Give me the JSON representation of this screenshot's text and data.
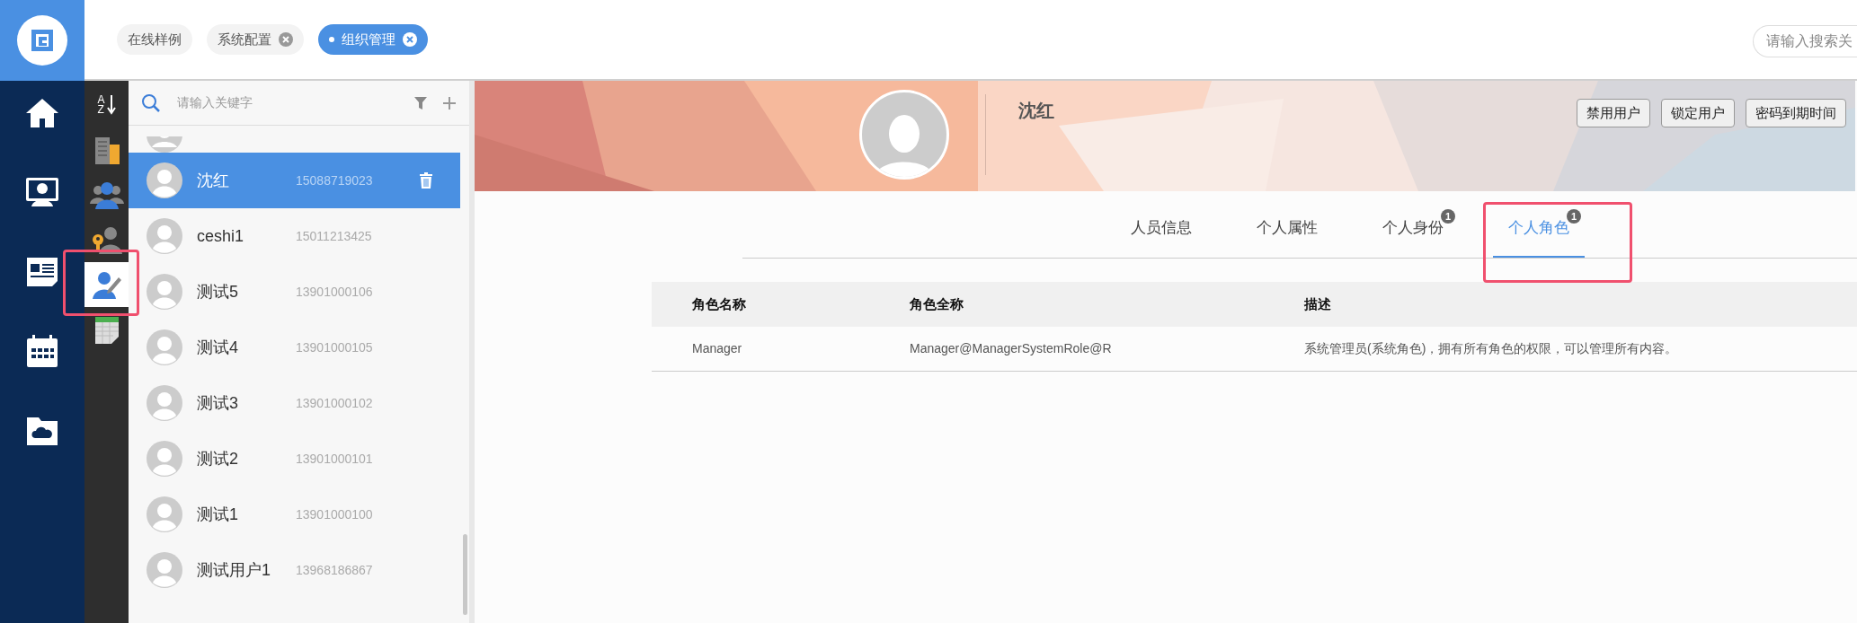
{
  "tags": [
    {
      "label": "在线样例",
      "closable": false,
      "selected": false
    },
    {
      "label": "系统配置",
      "closable": true,
      "selected": false
    },
    {
      "label": "组织管理",
      "closable": true,
      "selected": true
    }
  ],
  "global_search": {
    "placeholder": "请输入搜索关"
  },
  "nav": [
    {
      "kind": "home"
    },
    {
      "kind": "monitor"
    },
    {
      "kind": "news"
    },
    {
      "kind": "calendar"
    },
    {
      "kind": "cloud-folder"
    }
  ],
  "tools": [
    {
      "kind": "sort",
      "letters": [
        "A",
        "Z"
      ],
      "selected": false,
      "highlighted": false
    },
    {
      "kind": "building",
      "selected": false,
      "highlighted": false
    },
    {
      "kind": "group",
      "selected": false,
      "highlighted": false
    },
    {
      "kind": "person-key",
      "selected": false,
      "highlighted": false
    },
    {
      "kind": "person-edit",
      "selected": true,
      "highlighted": true
    },
    {
      "kind": "sheet",
      "selected": false,
      "highlighted": false
    }
  ],
  "user_list": {
    "search": {
      "placeholder": "请输入关键字"
    },
    "users": [
      {
        "name": "沈红",
        "phone": "15088719023",
        "selected": true
      },
      {
        "name": "ceshi1",
        "phone": "15011213425",
        "selected": false
      },
      {
        "name": "测试5",
        "phone": "13901000106",
        "selected": false
      },
      {
        "name": "测试4",
        "phone": "13901000105",
        "selected": false
      },
      {
        "name": "测试3",
        "phone": "13901000102",
        "selected": false
      },
      {
        "name": "测试2",
        "phone": "13901000101",
        "selected": false
      },
      {
        "name": "测试1",
        "phone": "13901000100",
        "selected": false
      },
      {
        "name": "测试用户1",
        "phone": "13968186867",
        "selected": false
      }
    ]
  },
  "profile": {
    "name": "沈红",
    "actions": [
      "禁用用户",
      "锁定用户",
      "密码到期时间"
    ]
  },
  "tabs": [
    {
      "label": "人员信息",
      "selected": false,
      "highlighted": false
    },
    {
      "label": "个人属性",
      "selected": false,
      "highlighted": false
    },
    {
      "label": "个人身份",
      "badge": "1",
      "selected": false,
      "highlighted": false
    },
    {
      "label": "个人角色",
      "badge": "1",
      "selected": true,
      "highlighted": true
    }
  ],
  "roles_table": {
    "columns": [
      "角色名称",
      "角色全称",
      "描述"
    ],
    "rows": [
      [
        "Manager",
        "Manager@ManagerSystemRole@R",
        "系统管理员(系统角色)，拥有所有角色的权限，可以管理所有内容。"
      ]
    ]
  }
}
